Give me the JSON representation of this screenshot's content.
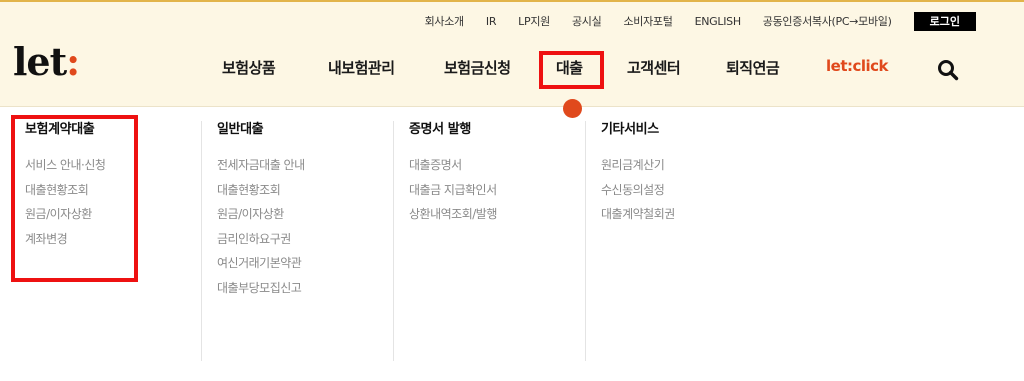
{
  "util_nav": [
    "회사소개",
    "IR",
    "LP지원",
    "공시실",
    "소비자포털",
    "ENGLISH",
    "공동인증서복사(PC→모바일)"
  ],
  "login_label": "로그인",
  "logo": {
    "text": "let",
    "accent": ":"
  },
  "gnb": [
    "보험상품",
    "내보험관리",
    "보험금신청",
    "대출",
    "고객센터",
    "퇴직연금",
    "let:click"
  ],
  "active_gnb": "대출",
  "menu": [
    {
      "title": "보험계약대출",
      "items": [
        "서비스 안내·신청",
        "대출현황조회",
        "원금/이자상환",
        "계좌변경"
      ]
    },
    {
      "title": "일반대출",
      "items": [
        "전세자금대출 안내",
        "대출현황조회",
        "원금/이자상환",
        "금리인하요구권",
        "여신거래기본약관",
        "대출부당모집신고"
      ]
    },
    {
      "title": "증명서 발행",
      "items": [
        "대출증명서",
        "대출금 지급확인서",
        "상환내역조회/발행"
      ]
    },
    {
      "title": "기타서비스",
      "items": [
        "원리금계산기",
        "수신동의설정",
        "대출계약철회권"
      ]
    }
  ],
  "colors": {
    "brand": "#e0491c",
    "header_bg": "#fdf7e4",
    "highlight": "#ee1111"
  },
  "icons": {
    "search": "search-icon"
  }
}
